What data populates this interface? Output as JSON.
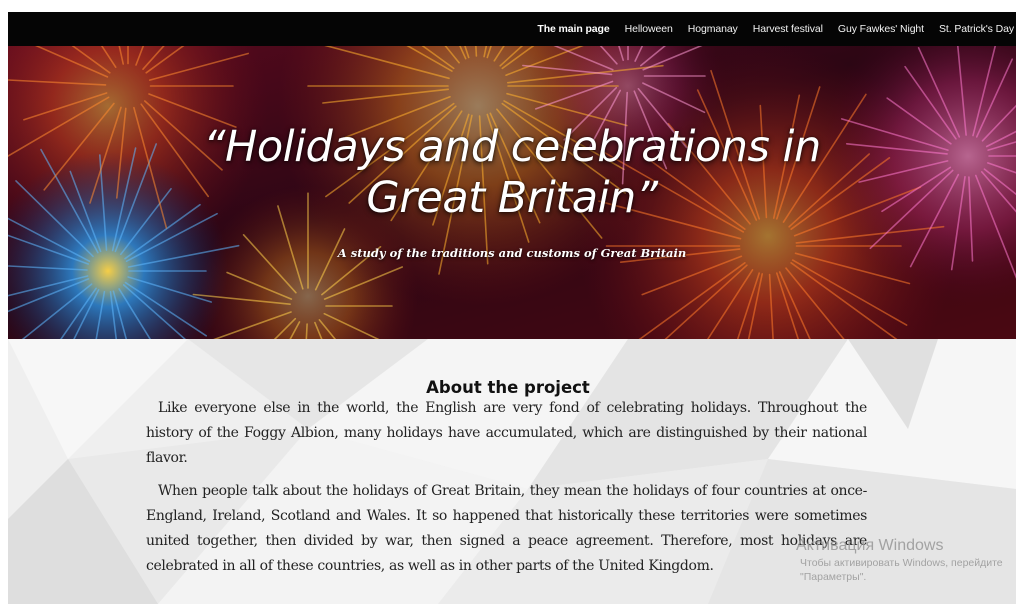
{
  "nav": {
    "items": [
      {
        "label": "The main page",
        "active": true
      },
      {
        "label": "Helloween",
        "active": false
      },
      {
        "label": "Hogmanay",
        "active": false
      },
      {
        "label": "Harvest festival",
        "active": false
      },
      {
        "label": "Guy Fawkes' Night",
        "active": false
      },
      {
        "label": "St. Patrick's Day",
        "active": false
      }
    ]
  },
  "hero": {
    "title_line1": "“Holidays and celebrations in",
    "title_line2": "Great Britain”",
    "subtitle": "A study of the traditions and customs of Great Britain"
  },
  "about": {
    "heading": "About the project",
    "paragraphs": [
      "Like everyone else in the world, the English are very fond of celebrating holidays. Throughout the history of the Foggy Albion, many holidays have accumulated, which are distinguished by their national flavor.",
      "When people talk about the holidays of Great Britain, they mean the holidays of four countries at once-England, Ireland, Scotland and Wales. It so happened that historically these territories were sometimes united together, then divided by war, then signed a peace agreement. Therefore, most holidays are celebrated in all of these countries, as well as in other parts of the United Kingdom."
    ]
  },
  "watermark": {
    "title": "Активация Windows",
    "line1": "Чтобы активировать Windows, перейдите",
    "line2": "\"Параметры\"."
  },
  "colors": {
    "navbar_bg": "#050505",
    "hero_bg": "#3a0612",
    "about_bg": "#f1f1f1",
    "body_text": "#222222"
  }
}
